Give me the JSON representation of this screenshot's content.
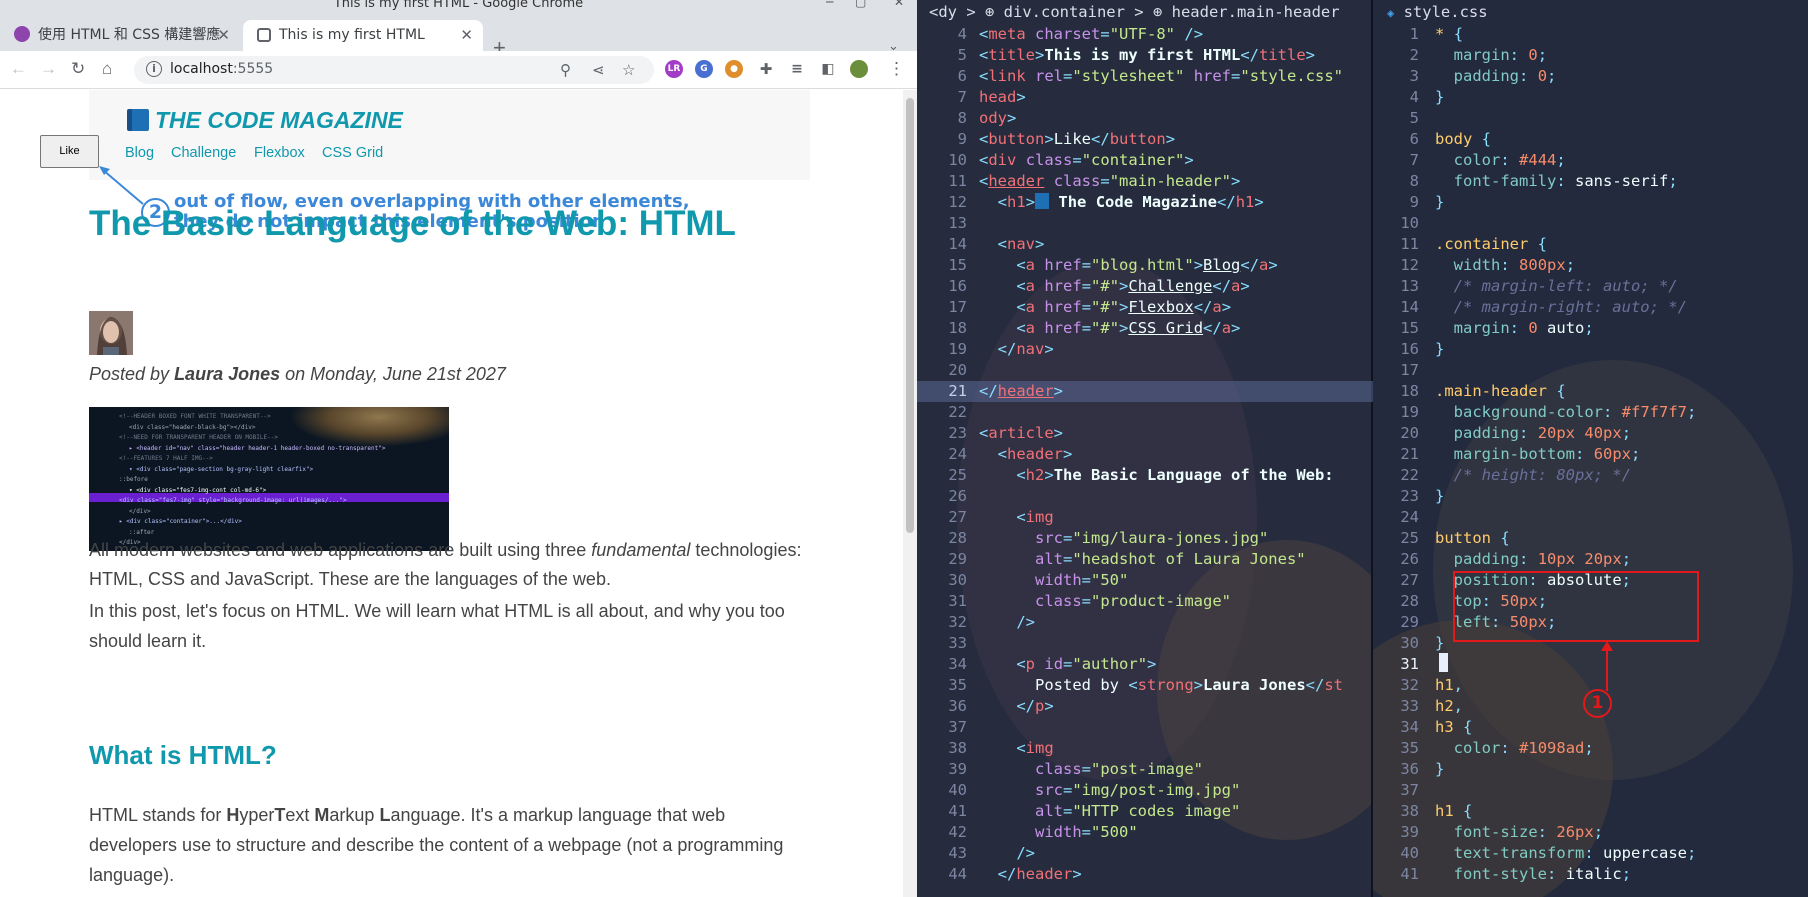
{
  "window": {
    "title": "This is my first HTML - Google Chrome"
  },
  "tabs": [
    {
      "label": "使用 HTML 和 CSS 構建響應",
      "favicon_color": "#8e44ad"
    },
    {
      "label": "This is my first HTML",
      "active": true
    }
  ],
  "omnibox": {
    "host": "localhost",
    "port": ":5555"
  },
  "page": {
    "site_title": "The Code Magazine",
    "like_label": "Like",
    "nav": [
      "Blog",
      "Challenge",
      "Flexbox",
      "CSS Grid"
    ],
    "annotation": {
      "number": "2",
      "line1": "out of flow, even overlapping with other elements,",
      "line2": "they do not impact this element's position"
    },
    "post_title": "The Basic Language of the Web: HTML",
    "author_prefix": "Posted by ",
    "author_name": "Laura Jones",
    "author_suffix": " on Monday, June 21st 2027",
    "p1_a": "All modern websites and web applications are built using three ",
    "p1_em": "fundamental",
    "p1_b": " technologies: HTML, CSS and JavaScript. These are the languages of the web.",
    "p2": "In this post, let's focus on HTML. We will learn what HTML is all about, and why you too should learn it.",
    "h3": "What is HTML?",
    "p3_intro": "HTML stands for ",
    "p3_h": "H",
    "p3_yper": "yper",
    "p3_t": "T",
    "p3_ext": "ext ",
    "p3_m": "M",
    "p3_arkup": "arkup ",
    "p3_l": "L",
    "p3_anguage": "anguage",
    "p3_rest": ". It's a markup language that web developers use to structure and describe the content of a webpage (not a programming language).",
    "post_img_lines": [
      "<!--HEADER BOXED FONT WHITE TRANSPARENT-->",
      "<div class=\"header-black-bg\"></div>",
      "<!--NEED FOR TRANSPARENT HEADER ON MOBILE-->",
      "▸ <header id=\"nav\" class=\"header header-1 header-boxed no-transparent\">",
      "<!--FEATURES 7 HALF IMG-->",
      "▾ <div class=\"page-section bg-gray-light clearfix\">",
      "::before",
      "▾ <div class=\"fes7-img-cont col-md-6\">",
      "<div class=\"fes7-img\" style=\"background-image: url(images/...\">",
      "</div>",
      "▸ <div class=\"container\">...</div>",
      "::after",
      "</div>"
    ]
  },
  "editor_html": {
    "breadcrumb": "<dy > ⊕ div.container > ⊕ header.main-header",
    "highlight_line": "21"
  },
  "editor_css": {
    "file_name": "style.css",
    "file_icon": "css-file-icon",
    "annotation_number": "1"
  },
  "colors": {
    "accent": "#1098ad",
    "text": "#444444",
    "header_bg": "#f7f7f7",
    "annotation_blue": "#3b87d8",
    "annotation_red": "#e2181b"
  }
}
